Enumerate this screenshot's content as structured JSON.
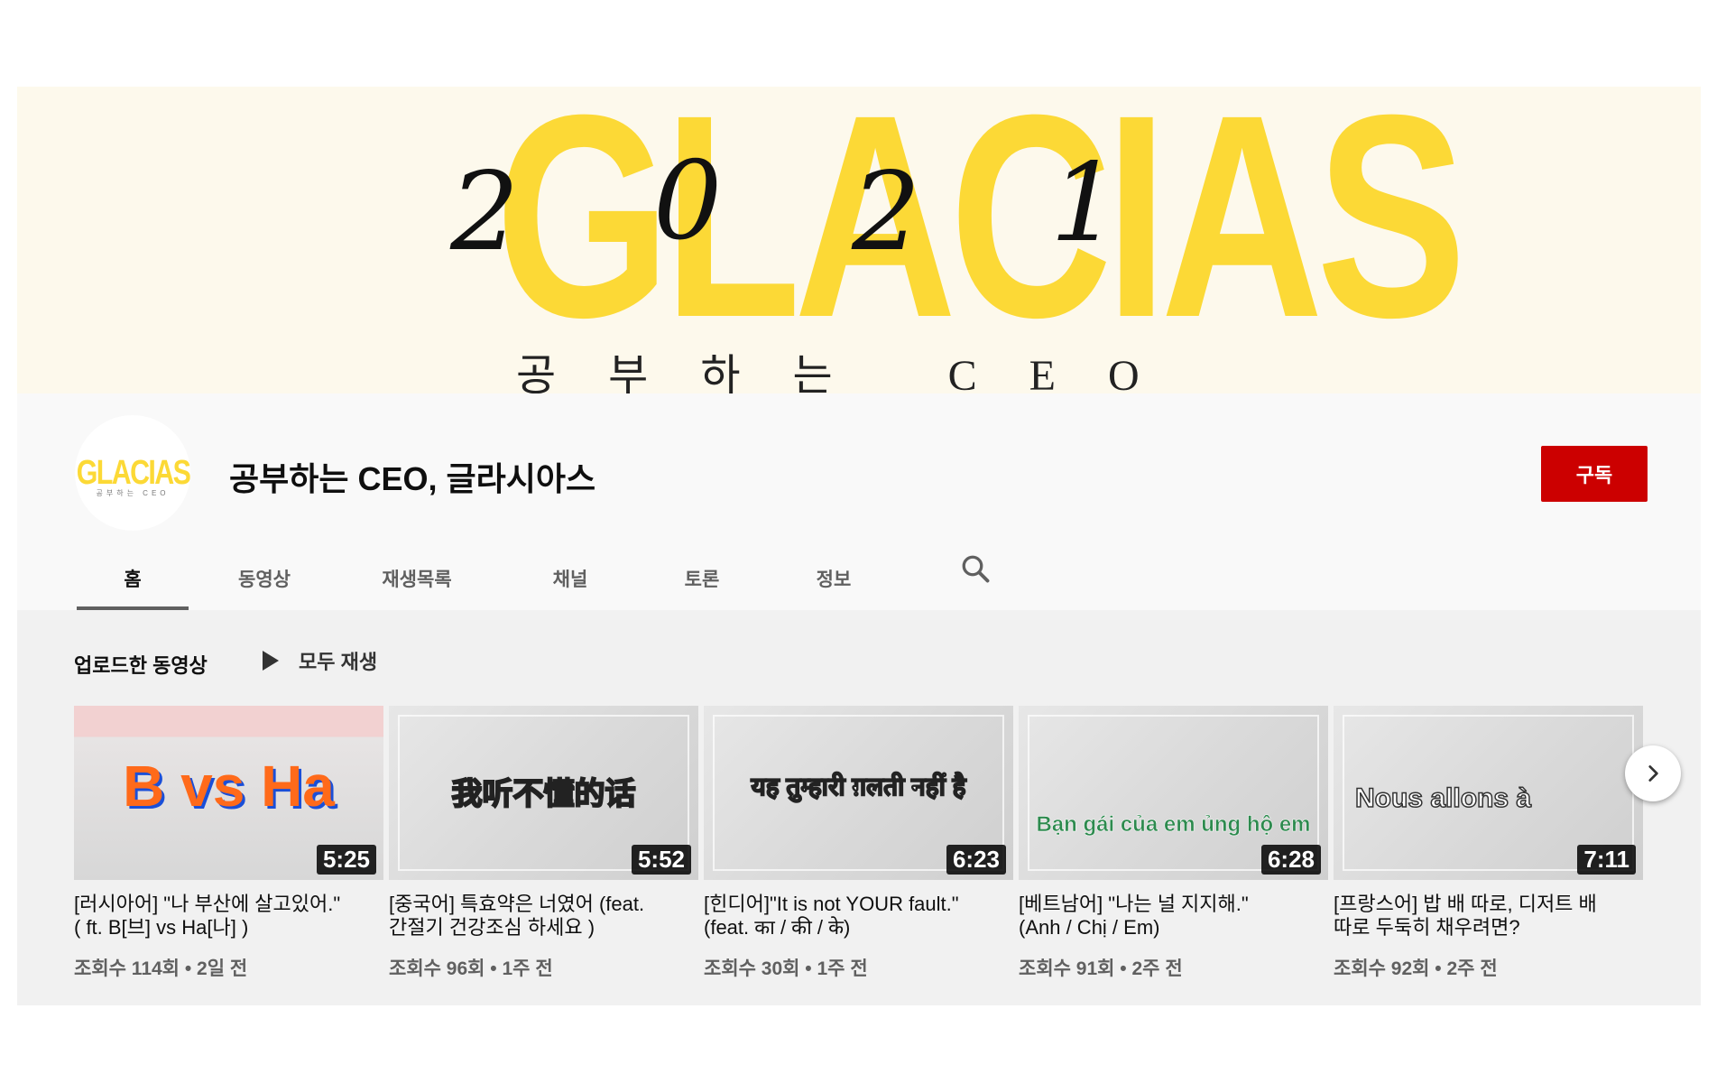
{
  "banner": {
    "logo": "GLACIAS",
    "year_digits": [
      "2",
      "0",
      "2",
      "1"
    ],
    "subtitle": "공부하는 CEO"
  },
  "channel": {
    "avatar_logo": "GLACIAS",
    "avatar_sub": "공부하는 CEO",
    "title": "공부하는 CEO, 글라시아스",
    "subscribe_label": "구독"
  },
  "tabs": [
    {
      "label": "홈",
      "active": true
    },
    {
      "label": "동영상",
      "active": false
    },
    {
      "label": "재생목록",
      "active": false
    },
    {
      "label": "채널",
      "active": false
    },
    {
      "label": "토론",
      "active": false
    },
    {
      "label": "정보",
      "active": false
    }
  ],
  "section": {
    "title": "업로드한 동영상",
    "play_all": "모두 재생"
  },
  "videos": [
    {
      "thumb_text": "B vs Ha",
      "duration": "5:25",
      "title_line1": "[러시아어] \"나 부산에 살고있어.\"",
      "title_line2": "( ft. B[브] vs Ha[나] )",
      "meta": "조회수 114회 • 2일 전"
    },
    {
      "thumb_text": "我听不懂的话",
      "duration": "5:52",
      "title_line1": "[중국어] 특효약은 너였어 (feat.",
      "title_line2": "간절기 건강조심 하세요 )",
      "meta": "조회수 96회 • 1주 전"
    },
    {
      "thumb_text": "यह तुम्हारी ग़लती नहीं है",
      "duration": "6:23",
      "title_line1": "[힌디어]\"It is not YOUR fault.\"",
      "title_line2": "(feat. का / की / के)",
      "meta": "조회수 30회 • 1주 전"
    },
    {
      "thumb_text": "Bạn gái của em ủng hộ em",
      "duration": "6:28",
      "title_line1": "[베트남어] \"나는 널 지지해.\"",
      "title_line2": "(Anh / Chị / Em)",
      "meta": "조회수 91회 • 2주 전"
    },
    {
      "thumb_text": "Nous allons à",
      "duration": "7:11",
      "title_line1": "[프랑스어] 밥 배 따로, 디저트 배",
      "title_line2": "따로 두둑히 채우려면?",
      "meta": "조회수 92회 • 2주 전"
    }
  ],
  "icons": {
    "search": "search-icon",
    "next": "chevron-right-icon",
    "play": "play-icon"
  },
  "colors": {
    "banner_bg": "#fdf9ec",
    "brand_yellow": "#fcd936",
    "subscribe_red": "#cc0000",
    "header_bg": "#f9f9f9",
    "content_bg": "#f1f1f1"
  }
}
